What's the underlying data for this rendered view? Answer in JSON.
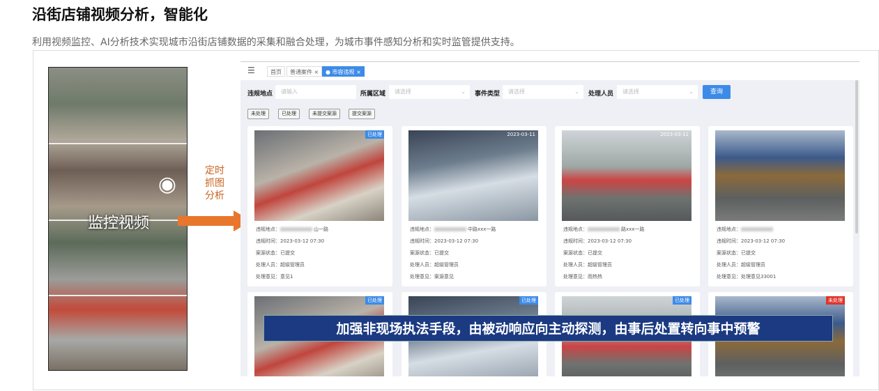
{
  "title": "沿街店铺视频分析，智能化",
  "subtitle": "利用视频监控、AI分析技术实现城市沿街店铺数据的采集和融合处理，为城市事件感知分析和实时监管提供支持。",
  "left": {
    "video_label": "监控视频",
    "arrow_label": "定时抓图分析"
  },
  "app": {
    "tabs": [
      {
        "label": "首页"
      },
      {
        "label": "普通案件 ×"
      },
      {
        "label": "● 市容违规 ×"
      }
    ],
    "filters": {
      "location_label": "违规地点",
      "location_placeholder": "请输入",
      "area_label": "所属区域",
      "area_placeholder": "请选择",
      "type_label": "事件类型",
      "type_placeholder": "请选择",
      "handler_label": "处理人员",
      "handler_placeholder": "请选择",
      "query": "查询"
    },
    "chips": [
      "未处理",
      "已处理",
      "未提交案源",
      "提交案源"
    ],
    "field_labels": {
      "location": "违规地点：",
      "time": "违规时间：",
      "status": "案源状态：",
      "handler": "处理人员：",
      "opinion": "处理意见："
    },
    "cards": [
      {
        "badge": "已处理",
        "location": "山一路",
        "time": "2023-03-12 07:30",
        "status": "已提交",
        "handler": "超级管理员",
        "opinion": "意见1",
        "img_time": ""
      },
      {
        "badge": "",
        "location": "中路xxx一路",
        "time": "2023-03-12 07:30",
        "status": "已提交",
        "handler": "超级管理员",
        "opinion": "案源意见",
        "img_time": "2023-03-11"
      },
      {
        "badge": "",
        "location": "路xxx一路",
        "time": "2023-03-12 07:30",
        "status": "已提交",
        "handler": "超级管理员",
        "opinion": "而热热",
        "img_time": "2023-03-11"
      },
      {
        "badge": "",
        "location": "",
        "time": "2023-03-12 07:30",
        "status": "已提交",
        "handler": "超级管理员",
        "opinion": "处理意见33001",
        "img_time": ""
      },
      {
        "badge": "已处理"
      },
      {
        "badge": "已处理"
      },
      {
        "badge": "已处理"
      },
      {
        "badge": "未处理"
      }
    ]
  },
  "banner": "加强非现场执法手段，由被动响应向主动探测，由事后处置转向事中预警"
}
